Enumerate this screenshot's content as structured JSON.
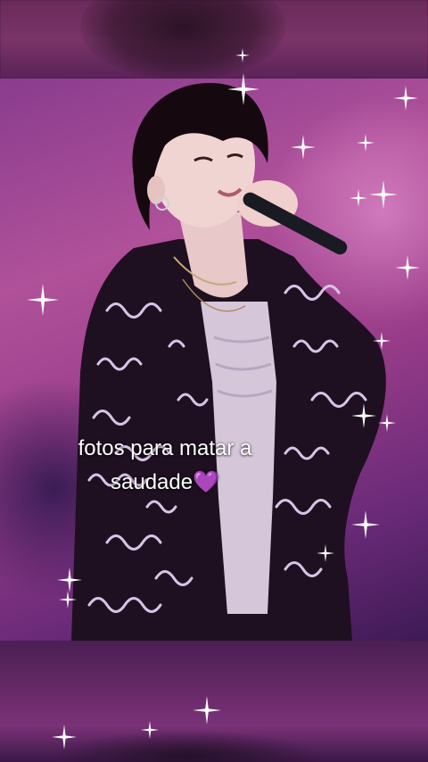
{
  "caption": {
    "line1": "fotos para matar a",
    "line2": "saudade💜"
  },
  "colors": {
    "background_purple": "#9a3d8a",
    "jacket": "#1e1020",
    "shirt": "#d8c8dc",
    "text": "#ffffff"
  },
  "decorations": {
    "sparkle_icon": "four-point-star"
  }
}
